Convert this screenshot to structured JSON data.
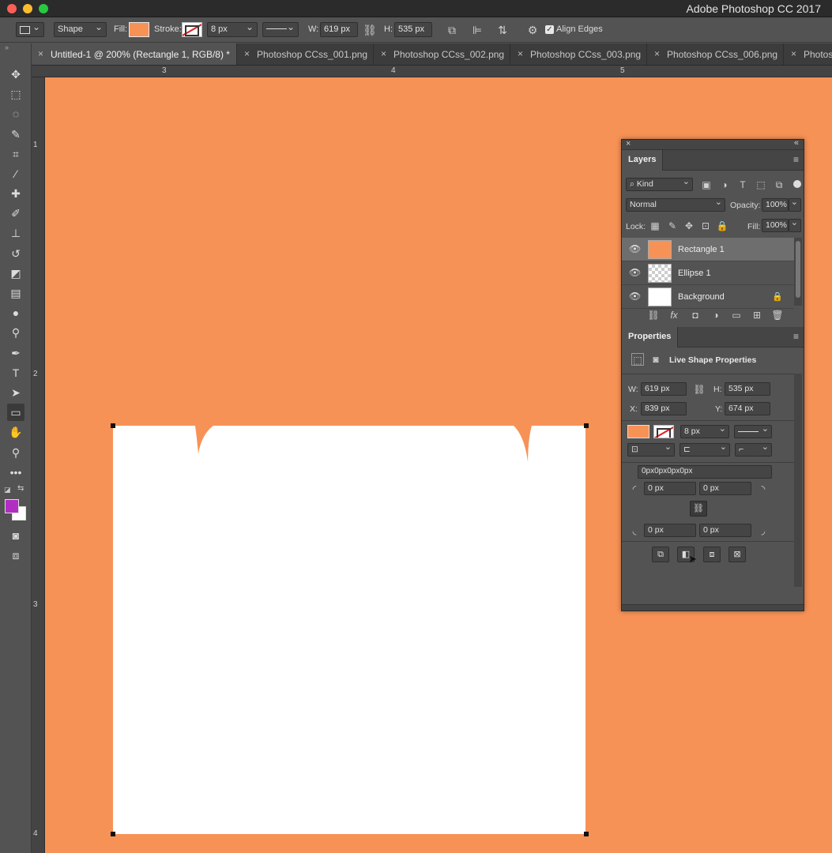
{
  "titlebar": {
    "app_title": "Adobe Photoshop CC 2017"
  },
  "options": {
    "mode": "Shape",
    "fill_label": "Fill:",
    "fill_color": "#f79257",
    "stroke_label": "Stroke:",
    "stroke_width": "8 px",
    "w_label": "W:",
    "w_value": "619 px",
    "h_label": "H:",
    "h_value": "535 px",
    "align_edges_label": "Align Edges"
  },
  "tabs": [
    {
      "label": "Untitled-1 @ 200% (Rectangle 1, RGB/8) *",
      "active": true
    },
    {
      "label": "Photoshop CCss_001.png"
    },
    {
      "label": "Photoshop CCss_002.png"
    },
    {
      "label": "Photoshop CCss_003.png"
    },
    {
      "label": "Photoshop CCss_006.png"
    },
    {
      "label": "Photos"
    }
  ],
  "rulers": {
    "top": [
      "3",
      "4",
      "5"
    ],
    "left": [
      "1",
      "2",
      "3",
      "4"
    ]
  },
  "colors": {
    "canvas_bg": "#f79257",
    "foreground": "#b02fc0",
    "background": "#ffffff"
  },
  "layers_panel": {
    "title": "Layers",
    "filter_kind": "Kind",
    "blend_mode": "Normal",
    "opacity_label": "Opacity:",
    "opacity_value": "100%",
    "lock_label": "Lock:",
    "fill_label": "Fill:",
    "fill_value": "100%",
    "layers": [
      {
        "name": "Rectangle 1",
        "selected": true
      },
      {
        "name": "Ellipse 1"
      },
      {
        "name": "Background",
        "locked": true
      }
    ]
  },
  "properties_panel": {
    "title": "Properties",
    "subtitle": "Live Shape Properties",
    "w_label": "W:",
    "w_value": "619 px",
    "h_label": "H:",
    "h_value": "535 px",
    "x_label": "X:",
    "x_value": "839 px",
    "y_label": "Y:",
    "y_value": "674 px",
    "stroke_width": "8 px",
    "corner_summary": "0px0px0px0px",
    "corner_tl": "0 px",
    "corner_tr": "0 px",
    "corner_bl": "0 px",
    "corner_br": "0 px"
  }
}
